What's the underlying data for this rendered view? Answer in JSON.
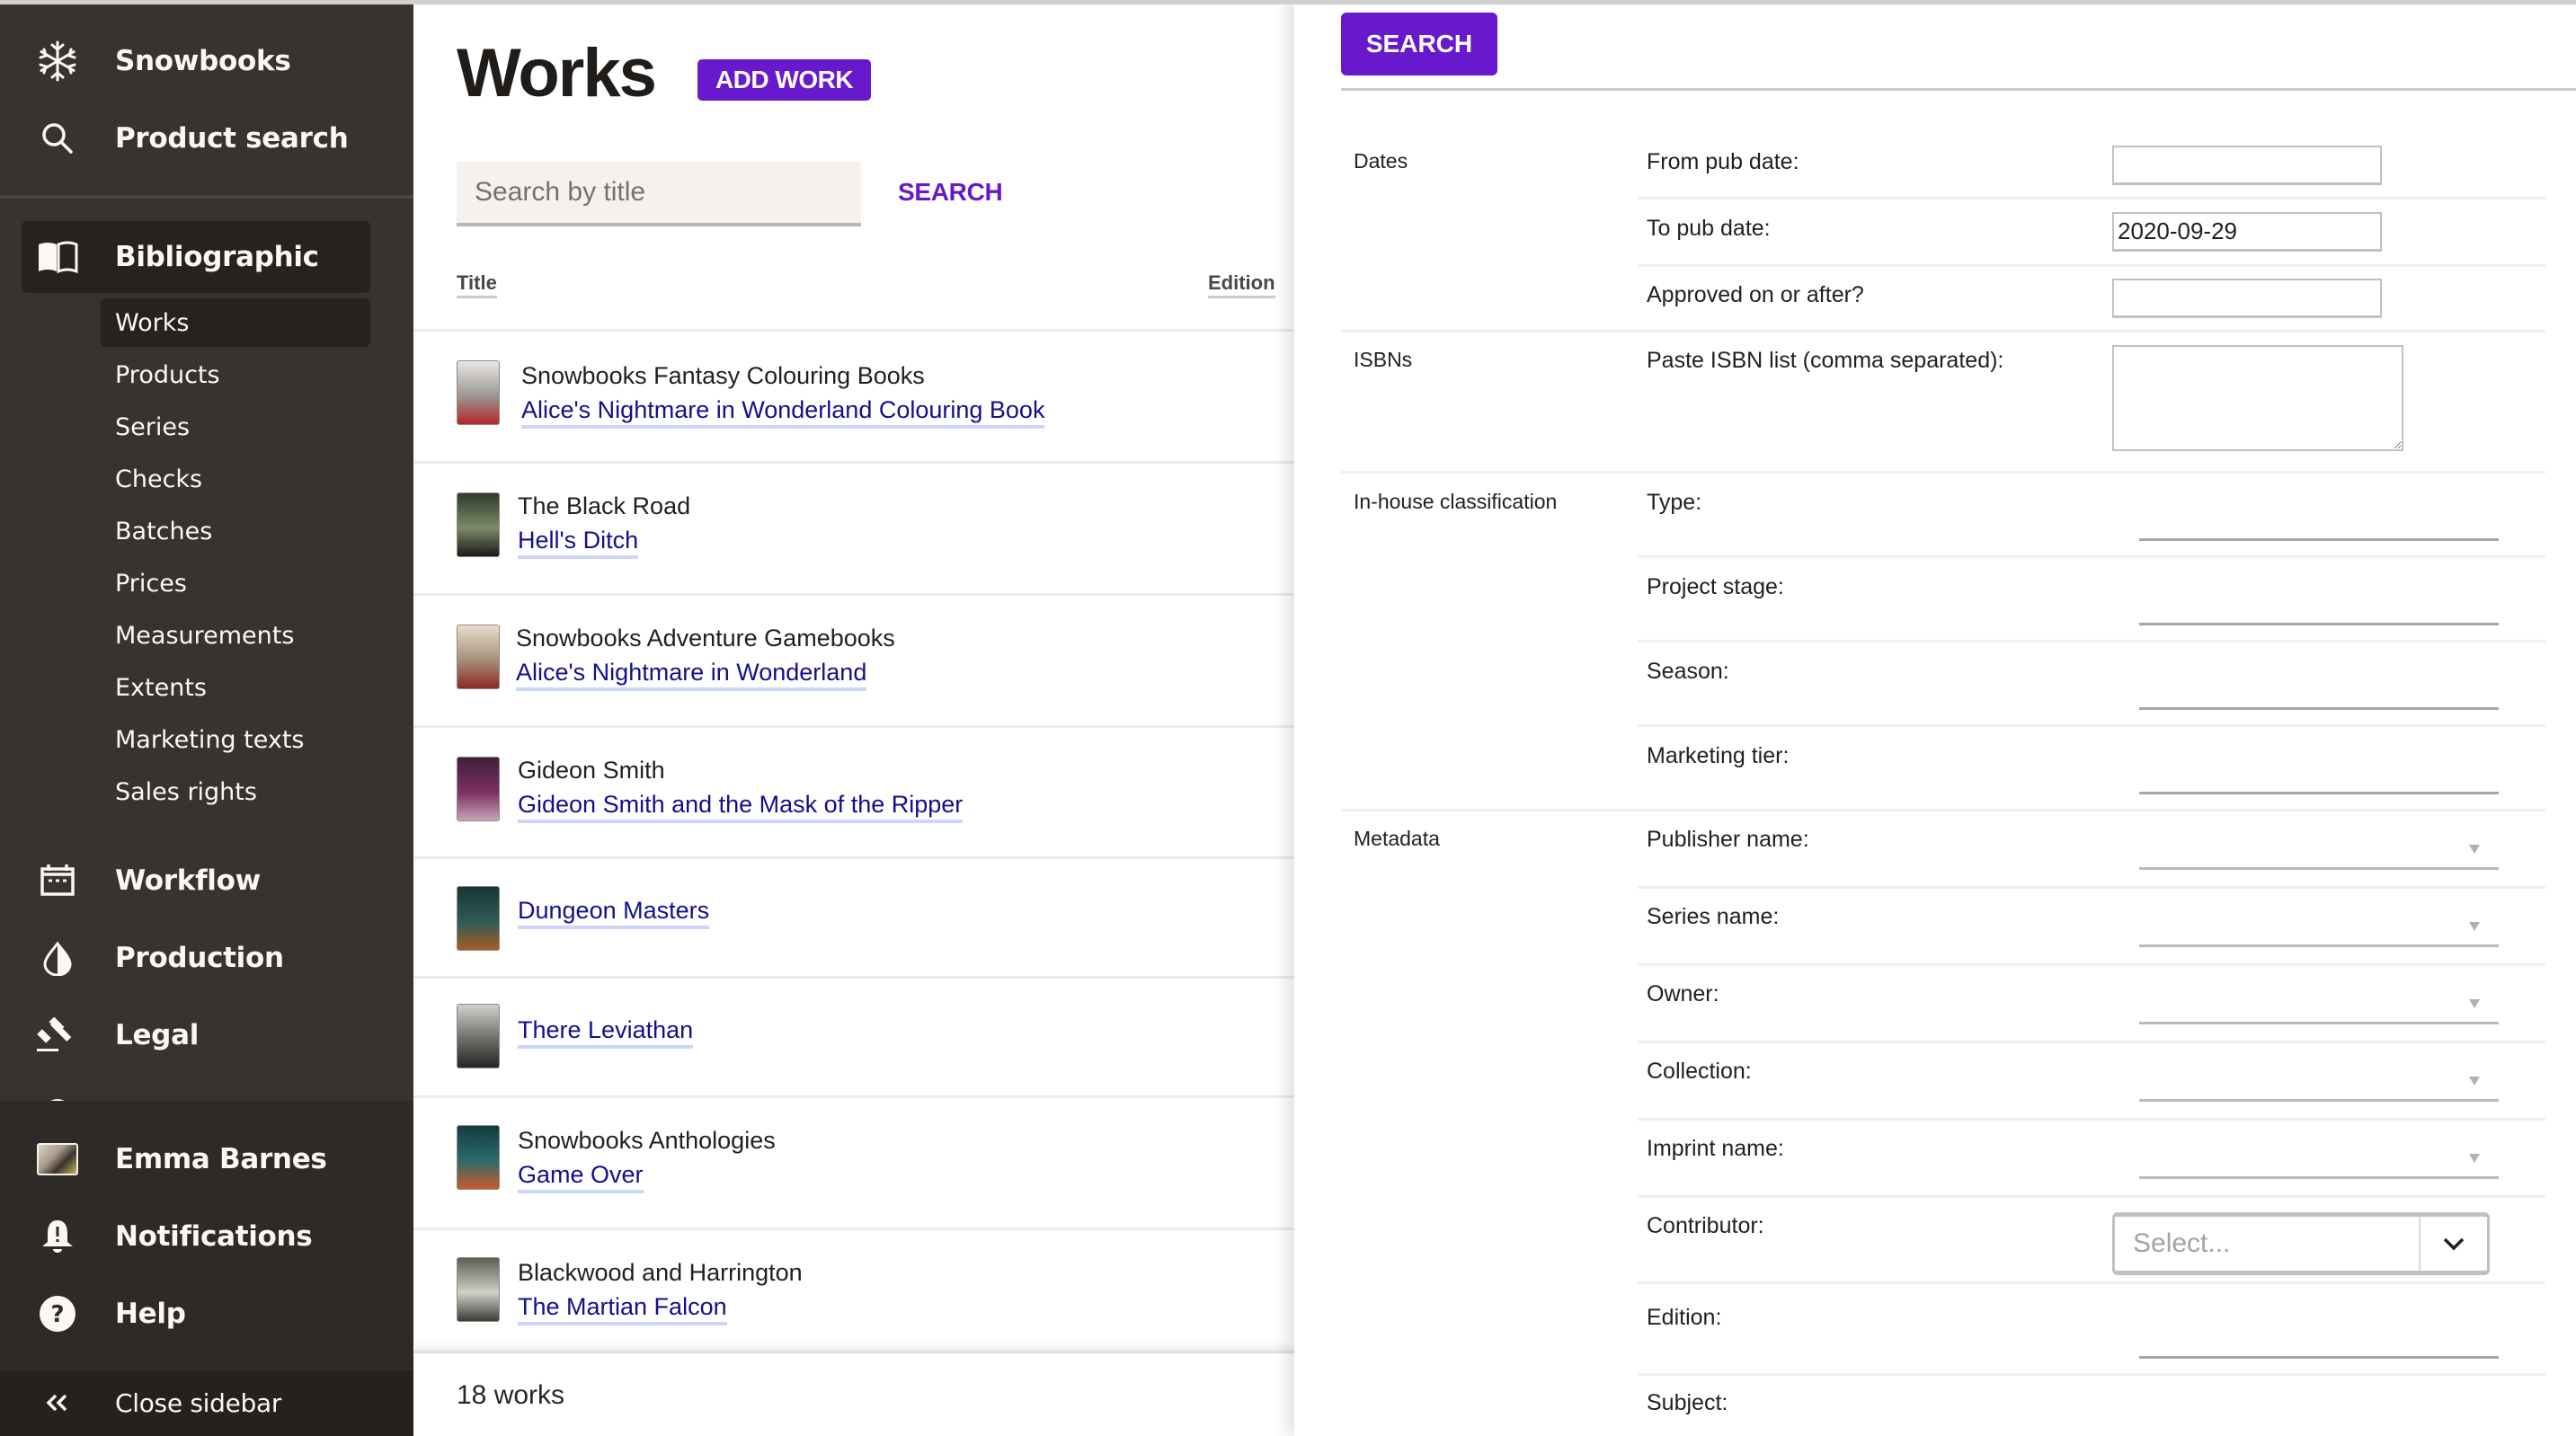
{
  "sidebar": {
    "brand": {
      "label": "Snowbooks",
      "icon": "snowflake-icon"
    },
    "product_search": {
      "label": "Product search",
      "icon": "search-icon"
    },
    "sections": [
      {
        "label": "Bibliographic",
        "icon": "open-book-icon",
        "active": true
      },
      {
        "label": "Workflow",
        "icon": "calendar-icon"
      },
      {
        "label": "Production",
        "icon": "drop-icon"
      },
      {
        "label": "Legal",
        "icon": "gavel-icon"
      }
    ],
    "sub_items": [
      {
        "label": "Works",
        "active": true
      },
      {
        "label": "Products"
      },
      {
        "label": "Series"
      },
      {
        "label": "Checks"
      },
      {
        "label": "Batches"
      },
      {
        "label": "Prices"
      },
      {
        "label": "Measurements"
      },
      {
        "label": "Extents"
      },
      {
        "label": "Marketing texts"
      },
      {
        "label": "Sales rights"
      }
    ],
    "user": {
      "label": "Emma Barnes",
      "icon": "avatar"
    },
    "notifications": {
      "label": "Notifications",
      "icon": "bell-alert-icon"
    },
    "help": {
      "label": "Help",
      "icon": "help-circle-icon"
    },
    "close": {
      "label": "Close sidebar",
      "icon": "double-chevron-left-icon"
    }
  },
  "main": {
    "title": "Works",
    "add_button": "ADD WORK",
    "search": {
      "placeholder": "Search by title",
      "value": "",
      "button": "SEARCH"
    },
    "columns": [
      "Title",
      "Edition"
    ],
    "rows": [
      {
        "series": "Snowbooks Fantasy Colouring Books",
        "title": "Alice's Nightmare in Wonderland Colouring Book",
        "cover_colors": [
          "#e8e6e3",
          "#9b9792",
          "#b3262b"
        ]
      },
      {
        "series": "The Black Road",
        "title": "Hell's Ditch",
        "cover_colors": [
          "#2f3b2c",
          "#7d8a6a",
          "#1a1a18"
        ]
      },
      {
        "series": "Snowbooks Adventure Gamebooks",
        "title": "Alice's Nightmare in Wonderland",
        "cover_colors": [
          "#e9dccb",
          "#a5917c",
          "#8c2a22"
        ]
      },
      {
        "series": "Gideon Smith",
        "title": "Gideon Smith and the Mask of the Ripper",
        "cover_colors": [
          "#3d1f3b",
          "#7a3160",
          "#c9a3b7"
        ]
      },
      {
        "series": "",
        "title": "Dungeon Masters",
        "cover_colors": [
          "#173436",
          "#2f5b58",
          "#a35f22"
        ]
      },
      {
        "series": "",
        "title": "There Leviathan",
        "cover_colors": [
          "#cfcfcc",
          "#6d6c69",
          "#252523"
        ]
      },
      {
        "series": "Snowbooks Anthologies",
        "title": "Game Over",
        "cover_colors": [
          "#143b3f",
          "#2b6b6b",
          "#c75b2c"
        ]
      },
      {
        "series": "Blackwood and Harrington",
        "title": "The Martian Falcon",
        "cover_colors": [
          "#5a5f54",
          "#cfd0c8",
          "#3c3d36"
        ]
      }
    ],
    "footer_count": "18 works"
  },
  "panel": {
    "search_button": "SEARCH",
    "sections": {
      "dates": {
        "label": "Dates",
        "from_pub_date": {
          "label": "From pub date:",
          "value": ""
        },
        "to_pub_date": {
          "label": "To pub date:",
          "value": "2020-09-29"
        },
        "approved_after": {
          "label": "Approved on or after?",
          "value": ""
        }
      },
      "isbns": {
        "label": "ISBNs",
        "field_label": "Paste ISBN list (comma separated):",
        "value": ""
      },
      "inhouse": {
        "label": "In-house classification",
        "fields": [
          "Type:",
          "Project stage:",
          "Season:",
          "Marketing tier:"
        ]
      },
      "metadata": {
        "label": "Metadata",
        "select_fields": [
          "Publisher name:",
          "Series name:",
          "Owner:",
          "Collection:",
          "Imprint name:"
        ],
        "contributor": {
          "label": "Contributor:",
          "placeholder": "Select..."
        },
        "edition": {
          "label": "Edition:"
        },
        "subject": {
          "label": "Subject:"
        }
      }
    }
  },
  "colors": {
    "accent": "#6919cc",
    "link": "#130f8e",
    "link_underline": "#ccd6f8",
    "sidebar_bg": "#38332f",
    "sidebar_active": "#26221f"
  }
}
